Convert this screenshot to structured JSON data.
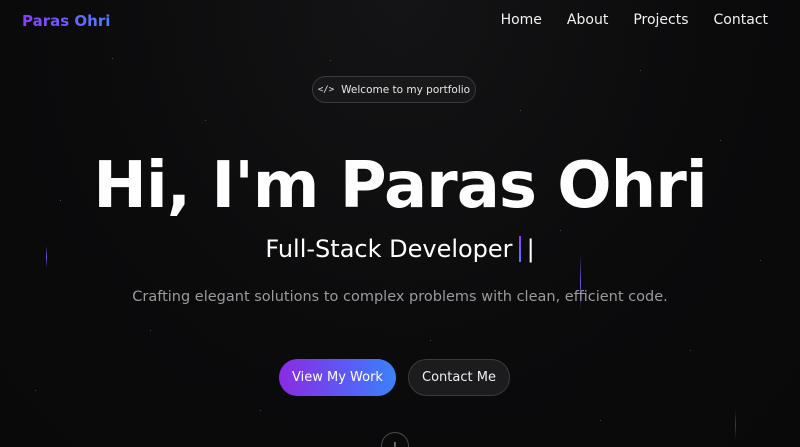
{
  "nav": {
    "logo": "Paras Ohri",
    "links": [
      {
        "label": "Home"
      },
      {
        "label": "About"
      },
      {
        "label": "Projects"
      },
      {
        "label": "Contact"
      }
    ]
  },
  "badge": {
    "icon": "code-icon",
    "text": "Welcome to my portfolio"
  },
  "hero": {
    "title": "Hi, I'm Paras Ohri",
    "subtitle": "Full-Stack Developer",
    "cursor": "|",
    "tagline": "Crafting elegant solutions to complex problems with clean, efficient code."
  },
  "buttons": {
    "primary": "View My Work",
    "secondary": "Contact Me"
  },
  "scroll": {
    "icon": "arrow-down-icon"
  },
  "colors": {
    "background": "#0a0a0b",
    "accent_start": "#8a2be2",
    "accent_end": "#3b82f6",
    "text_muted": "#9a9a9f"
  }
}
